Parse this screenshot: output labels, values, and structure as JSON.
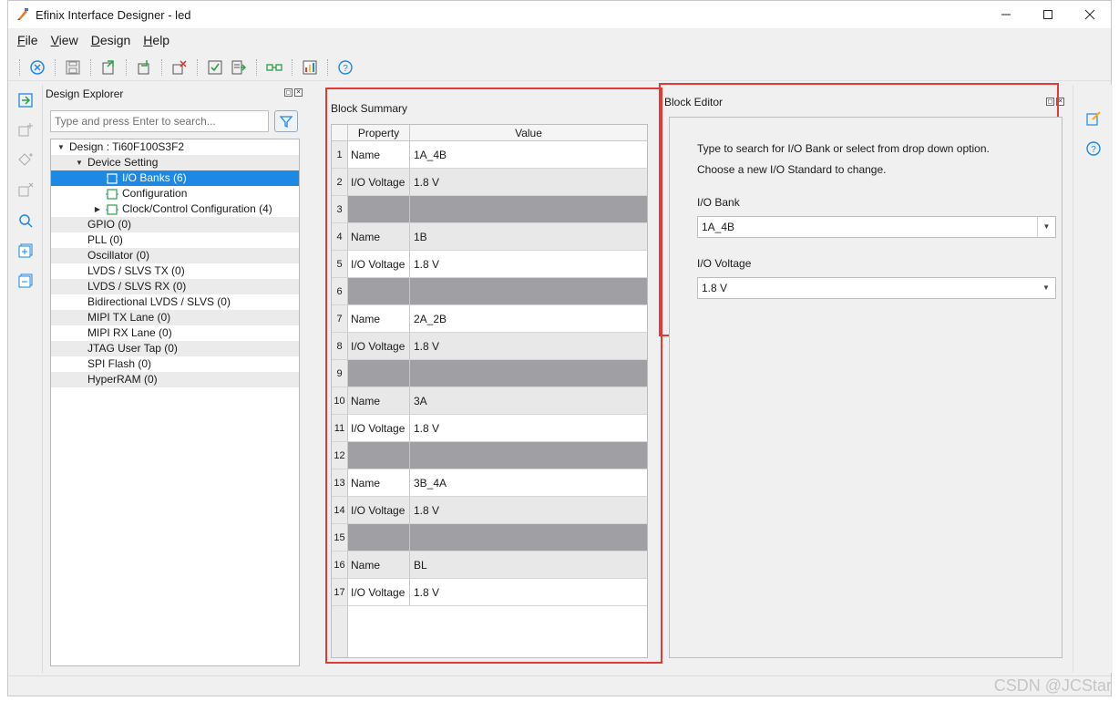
{
  "window": {
    "title": "Efinix Interface Designer - led"
  },
  "menu": [
    {
      "label": "File",
      "underline": "F",
      "rest": "ile"
    },
    {
      "label": "View",
      "underline": "V",
      "rest": "iew"
    },
    {
      "label": "Design",
      "underline": "D",
      "rest": "esign"
    },
    {
      "label": "Help",
      "underline": "H",
      "rest": "elp"
    }
  ],
  "explorer": {
    "title": "Design Explorer",
    "search_placeholder": "Type and press Enter to search...",
    "tree": [
      {
        "label": "Design : Ti60F100S3F2",
        "indent": 0,
        "caret": "down",
        "icon": "",
        "style": ""
      },
      {
        "label": "Device Setting",
        "indent": 1,
        "caret": "down",
        "icon": "",
        "style": "alt"
      },
      {
        "label": "I/O Banks (6)",
        "indent": 2,
        "caret": "",
        "icon": "io-banks-icon",
        "style": "sel"
      },
      {
        "label": "Configuration",
        "indent": 2,
        "caret": "",
        "icon": "configuration-icon",
        "style": ""
      },
      {
        "label": "Clock/Control Configuration (4)",
        "indent": 2,
        "caret": "right",
        "icon": "clock-config-icon",
        "style": ""
      },
      {
        "label": "GPIO (0)",
        "indent": 1,
        "caret": "",
        "icon": "",
        "style": "alt"
      },
      {
        "label": "PLL (0)",
        "indent": 1,
        "caret": "",
        "icon": "",
        "style": ""
      },
      {
        "label": "Oscillator (0)",
        "indent": 1,
        "caret": "",
        "icon": "",
        "style": "alt"
      },
      {
        "label": "LVDS / SLVS TX (0)",
        "indent": 1,
        "caret": "",
        "icon": "",
        "style": ""
      },
      {
        "label": "LVDS / SLVS RX (0)",
        "indent": 1,
        "caret": "",
        "icon": "",
        "style": "alt"
      },
      {
        "label": "Bidirectional LVDS / SLVS (0)",
        "indent": 1,
        "caret": "",
        "icon": "",
        "style": ""
      },
      {
        "label": "MIPI TX Lane (0)",
        "indent": 1,
        "caret": "",
        "icon": "",
        "style": "alt"
      },
      {
        "label": "MIPI RX Lane (0)",
        "indent": 1,
        "caret": "",
        "icon": "",
        "style": ""
      },
      {
        "label": "JTAG User Tap (0)",
        "indent": 1,
        "caret": "",
        "icon": "",
        "style": "alt"
      },
      {
        "label": "SPI Flash (0)",
        "indent": 1,
        "caret": "",
        "icon": "",
        "style": ""
      },
      {
        "label": "HyperRAM (0)",
        "indent": 1,
        "caret": "",
        "icon": "",
        "style": "alt"
      }
    ]
  },
  "summary": {
    "title": "Block Summary",
    "col_property": "Property",
    "col_value": "Value",
    "rows": [
      {
        "n": "1",
        "prop": "Name",
        "val": "1A_4B",
        "shade": "light"
      },
      {
        "n": "2",
        "prop": "I/O Voltage",
        "val": "1.8 V",
        "shade": "mid"
      },
      {
        "n": "3",
        "prop": "",
        "val": "",
        "shade": "dark"
      },
      {
        "n": "4",
        "prop": "Name",
        "val": "1B",
        "shade": "mid"
      },
      {
        "n": "5",
        "prop": "I/O Voltage",
        "val": "1.8 V",
        "shade": "light"
      },
      {
        "n": "6",
        "prop": "",
        "val": "",
        "shade": "dark"
      },
      {
        "n": "7",
        "prop": "Name",
        "val": "2A_2B",
        "shade": "light"
      },
      {
        "n": "8",
        "prop": "I/O Voltage",
        "val": "1.8 V",
        "shade": "mid"
      },
      {
        "n": "9",
        "prop": "",
        "val": "",
        "shade": "dark"
      },
      {
        "n": "10",
        "prop": "Name",
        "val": "3A",
        "shade": "mid"
      },
      {
        "n": "11",
        "prop": "I/O Voltage",
        "val": "1.8 V",
        "shade": "light"
      },
      {
        "n": "12",
        "prop": "",
        "val": "",
        "shade": "dark"
      },
      {
        "n": "13",
        "prop": "Name",
        "val": "3B_4A",
        "shade": "light"
      },
      {
        "n": "14",
        "prop": "I/O Voltage",
        "val": "1.8 V",
        "shade": "mid"
      },
      {
        "n": "15",
        "prop": "",
        "val": "",
        "shade": "dark"
      },
      {
        "n": "16",
        "prop": "Name",
        "val": "BL",
        "shade": "mid"
      },
      {
        "n": "17",
        "prop": "I/O Voltage",
        "val": "1.8 V",
        "shade": "light"
      }
    ]
  },
  "editor": {
    "title": "Block Editor",
    "hint1": "Type to search for I/O Bank or select from drop down option.",
    "hint2": "Choose a new I/O Standard to change.",
    "bank_label": "I/O Bank",
    "bank_value": "1A_4B",
    "voltage_label": "I/O Voltage",
    "voltage_value": "1.8 V"
  },
  "watermark": "CSDN @JCStar",
  "colors": {
    "selection": "#1e88e5",
    "highlight_frame": "#e53935",
    "separator_row": "#a0a0a4"
  }
}
